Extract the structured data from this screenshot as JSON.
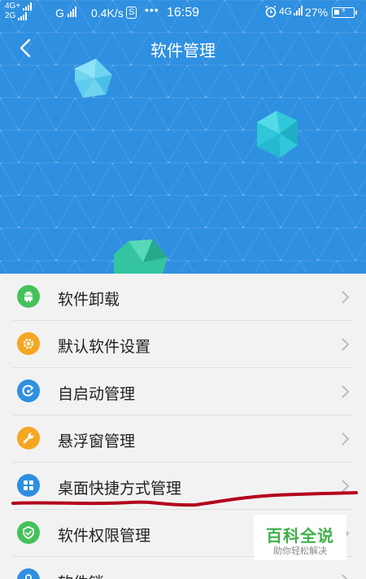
{
  "status_bar": {
    "net_top": "4G+",
    "net_bottom": "2G",
    "net_g": "G",
    "speed": "0.4K/s",
    "s_badge": "S",
    "dots": "•••",
    "time": "16:59",
    "net_right": "4G",
    "battery_pct": "27%"
  },
  "header": {
    "title": "软件管理"
  },
  "menu": {
    "items": [
      {
        "label": "软件卸载",
        "icon": "android-icon",
        "color": "#43c25a"
      },
      {
        "label": "默认软件设置",
        "icon": "gear-icon",
        "color": "#f5a623"
      },
      {
        "label": "自启动管理",
        "icon": "power-cycle-icon",
        "color": "#2f8fe0"
      },
      {
        "label": "悬浮窗管理",
        "icon": "wrench-icon",
        "color": "#f5a623"
      },
      {
        "label": "桌面快捷方式管理",
        "icon": "grid-icon",
        "color": "#2f8fe0"
      },
      {
        "label": "软件权限管理",
        "icon": "shield-icon",
        "color": "#43c25a"
      },
      {
        "label": "软件锁",
        "icon": "lock-icon",
        "color": "#2f8fe0"
      }
    ]
  },
  "watermark": {
    "main": "百科全说",
    "sub": "助你轻松解决"
  },
  "colors": {
    "header_bg": "#2f8fe0",
    "annotation": "#b3001b",
    "watermark_green": "#3fb14a"
  }
}
